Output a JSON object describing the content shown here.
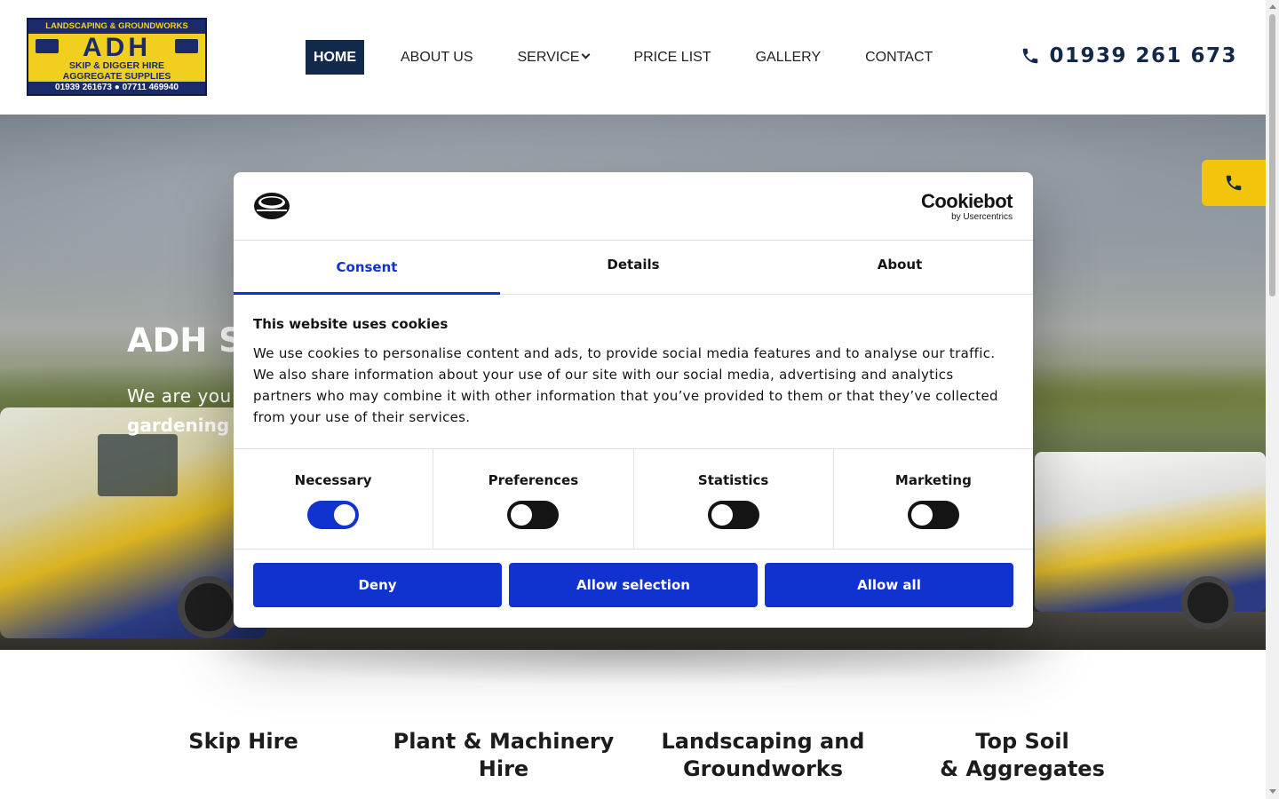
{
  "logo": {
    "top_text": "LANDSCAPING & GROUNDWORKS",
    "name": "ADH",
    "line2": "SKIP & DIGGER HIRE",
    "line3": "AGGREGATE SUPPLIES",
    "phones": "01939 261673 ● 07711 469940"
  },
  "nav": {
    "items": [
      {
        "label": "HOME"
      },
      {
        "label": "ABOUT US"
      },
      {
        "label": "SERVICE"
      },
      {
        "label": "PRICE LIST"
      },
      {
        "label": "GALLERY"
      },
      {
        "label": "CONTACT"
      }
    ]
  },
  "header": {
    "phone": "01939 261 673",
    "phone_icon": "phone-icon"
  },
  "hero": {
    "title": "ADH S",
    "text_line1": "We are you",
    "text_line2": "gardening p"
  },
  "side_call": {
    "icon": "phone-icon"
  },
  "services": [
    {
      "line1": "Skip Hire",
      "line2": ""
    },
    {
      "line1": "Plant & Machinery",
      "line2": "Hire"
    },
    {
      "line1": "Landscaping and",
      "line2": "Groundworks"
    },
    {
      "line1": "Top Soil",
      "line2": "& Aggregates"
    }
  ],
  "cookie": {
    "brand_name": "Cookiebot",
    "brand_sub": "by Usercentrics",
    "tabs": [
      {
        "label": "Consent"
      },
      {
        "label": "Details"
      },
      {
        "label": "About"
      }
    ],
    "title": "This website uses cookies",
    "text": "We use cookies to personalise content and ads, to provide social media features and to analyse our traffic. We also share information about your use of our site with our social media, advertising and analytics partners who may combine it with other information that you’ve provided to them or that they’ve collected from your use of their services.",
    "toggles": [
      {
        "label": "Necessary",
        "on": true
      },
      {
        "label": "Preferences",
        "on": false
      },
      {
        "label": "Statistics",
        "on": false
      },
      {
        "label": "Marketing",
        "on": false
      }
    ],
    "buttons": {
      "deny": "Deny",
      "allow_selection": "Allow selection",
      "allow_all": "Allow all"
    }
  },
  "colors": {
    "navy": "#13294b",
    "cookie_blue": "#1032cf",
    "accent_yellow": "#f2c40c"
  }
}
